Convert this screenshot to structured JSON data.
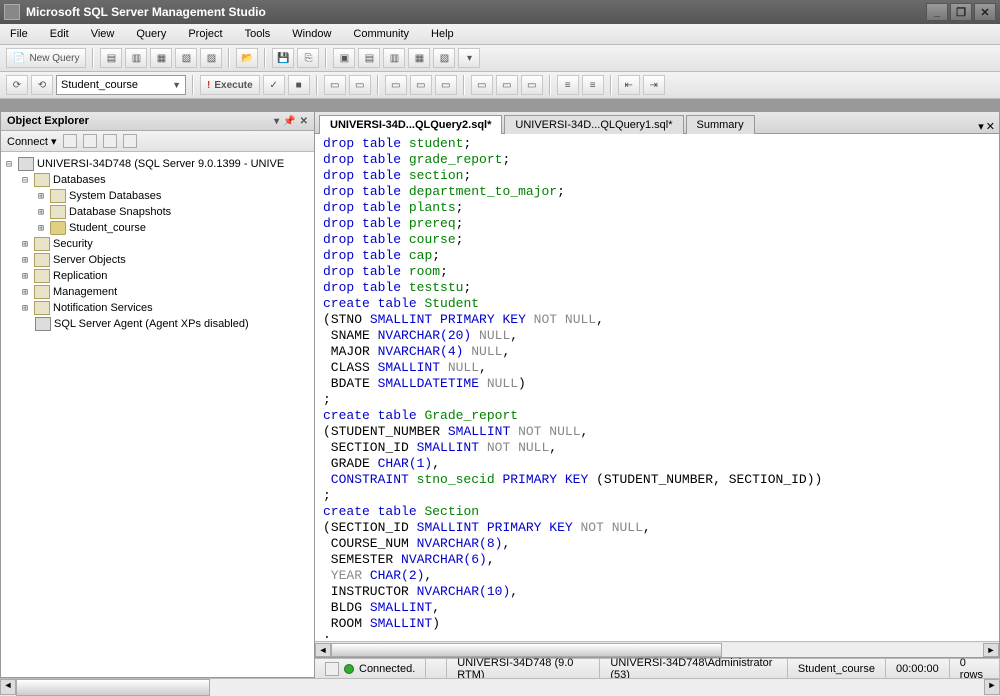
{
  "title": "Microsoft SQL Server Management Studio",
  "menu": [
    "File",
    "Edit",
    "View",
    "Query",
    "Project",
    "Tools",
    "Window",
    "Community",
    "Help"
  ],
  "newquery": "New Query",
  "dbselector": "Student_course",
  "execute": "Execute",
  "objexp": {
    "title": "Object Explorer",
    "connect": "Connect"
  },
  "tree": {
    "server": "UNIVERSI-34D748 (SQL Server 9.0.1399 - UNIVE",
    "databases": "Databases",
    "sysdb": "System Databases",
    "snapshots": "Database Snapshots",
    "studentcourse": "Student_course",
    "security": "Security",
    "serverobjects": "Server Objects",
    "replication": "Replication",
    "management": "Management",
    "notification": "Notification Services",
    "sqlagent": "SQL Server Agent (Agent XPs disabled)"
  },
  "tabs": {
    "t1": "UNIVERSI-34D...QLQuery2.sql*",
    "t2": "UNIVERSI-34D...QLQuery1.sql*",
    "t3": "Summary"
  },
  "status": {
    "connected": "Connected.",
    "server": "UNIVERSI-34D748 (9.0 RTM)",
    "user": "UNIVERSI-34D748\\Administrator (53)",
    "db": "Student_course",
    "time": "00:00:00",
    "rows": "0 rows"
  },
  "sql": {
    "drop": "drop",
    "table": "table",
    "create": "create",
    "not": " NOT",
    "null": " NULL",
    "nullonly": " NULL",
    "primarykey": " PRIMARY KEY",
    "constraint": " CONSTRAINT",
    "objs": {
      "student": " student",
      "grade_report": " grade_report",
      "section": " section",
      "dept": " department_to_major",
      "plants": " plants",
      "prereq": " prereq",
      "course": " course",
      "cap": " cap",
      "room": " room",
      "teststu": " teststu",
      "Student": " Student",
      "Grade_report": " Grade_report",
      "Section": " Section"
    },
    "cols": {
      "stno": "STNO ",
      "sname": " SNAME ",
      "major": " MAJOR ",
      "class": " CLASS ",
      "bdate": " BDATE ",
      "studentnum": "STUDENT_NUMBER ",
      "sectionid": " SECTION_ID ",
      "grade": " GRADE ",
      "stno_secid": " stno_secid",
      "keycols": " (STUDENT_NUMBER, SECTION_ID)",
      "sectionid2": "SECTION_ID ",
      "coursenum": " COURSE_NUM ",
      "semester": " SEMESTER ",
      "year": " YEAR ",
      "instructor": " INSTRUCTOR ",
      "bldg": " BLDG ",
      "room": " ROOM "
    },
    "types": {
      "smallint": "SMALLINT",
      "nvarchar20": "NVARCHAR(20)",
      "nvarchar4": "NVARCHAR(4)",
      "smalldatetime": "SMALLDATETIME",
      "char1": "CHAR(1)",
      "char2": "CHAR(2)",
      "nvarchar8": "NVARCHAR(8)",
      "nvarchar6": "NVARCHAR(6)",
      "nvarchar10": "NVARCHAR(10)"
    },
    "punct": {
      "semi": ";",
      "op": "(",
      "cp": ")",
      "comma": ","
    }
  }
}
